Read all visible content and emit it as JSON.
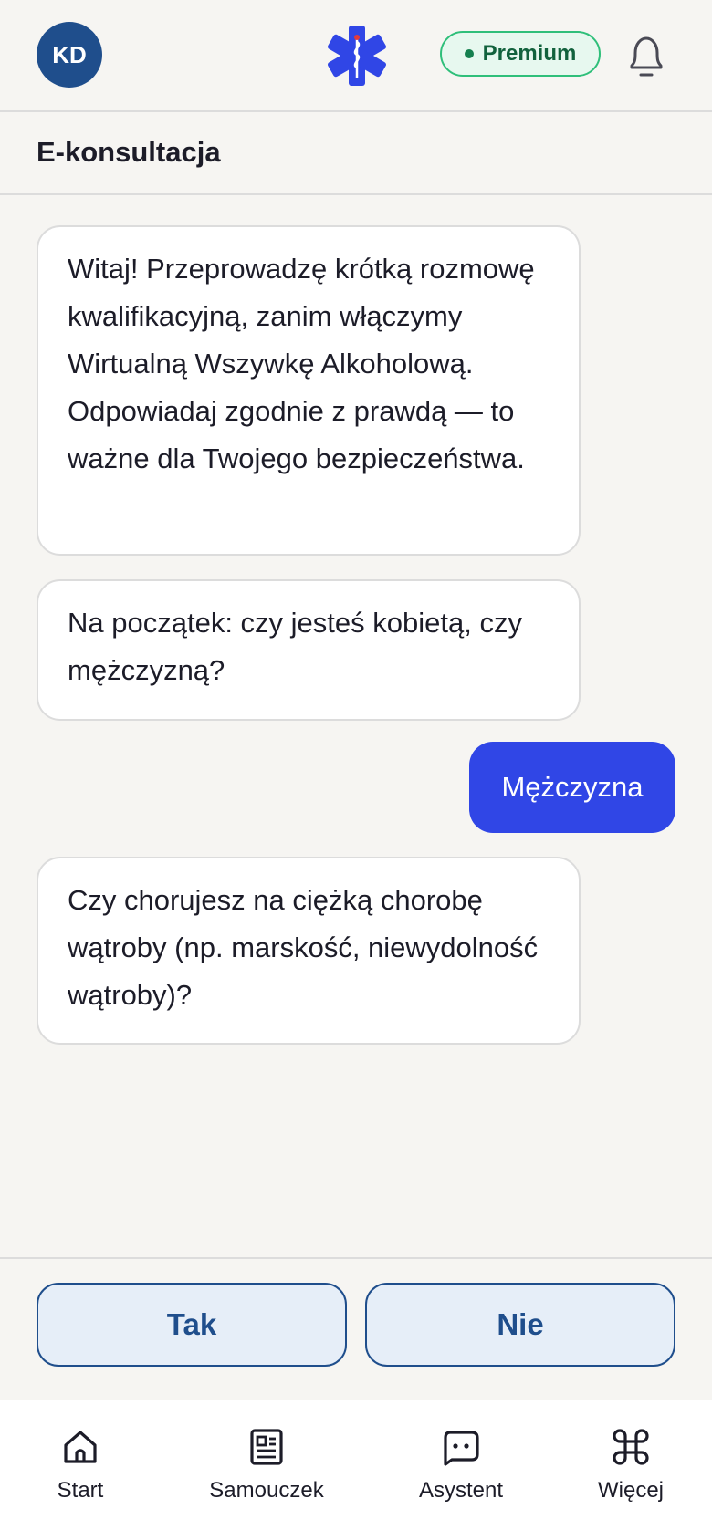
{
  "header": {
    "avatar_initials": "KD",
    "premium_label": "Premium",
    "logo_icon": "star-of-life-icon",
    "bell_icon": "bell-icon"
  },
  "page": {
    "title": "E-konsultacja"
  },
  "chat": {
    "messages": [
      {
        "from": "bot",
        "text": "Witaj! Przeprowadzę krótką rozmowę kwalifikacyjną, zanim włączymy Wirtualną Wszywkę Alkoholową. Odpowiadaj zgodnie z prawdą — to ważne dla Twojego bezpieczeństwa."
      },
      {
        "from": "bot",
        "text": "Na początek: czy jesteś kobietą, czy mężczyzną?"
      },
      {
        "from": "user",
        "text": "Mężczyzna"
      },
      {
        "from": "bot",
        "text": "Czy chorujesz na ciężką chorobę wątroby (np. marskość, niewydolność wątroby)?"
      }
    ]
  },
  "answers": {
    "yes": "Tak",
    "no": "Nie"
  },
  "nav": {
    "items": [
      {
        "label": "Start",
        "icon": "home-icon"
      },
      {
        "label": "Samouczek",
        "icon": "document-icon"
      },
      {
        "label": "Asystent",
        "icon": "chat-icon"
      },
      {
        "label": "Więcej",
        "icon": "command-icon"
      }
    ]
  },
  "colors": {
    "brand_blue": "#1f4e8c",
    "accent_blue": "#3046e6",
    "premium_green": "#2fbf7a",
    "background": "#f6f5f2"
  }
}
